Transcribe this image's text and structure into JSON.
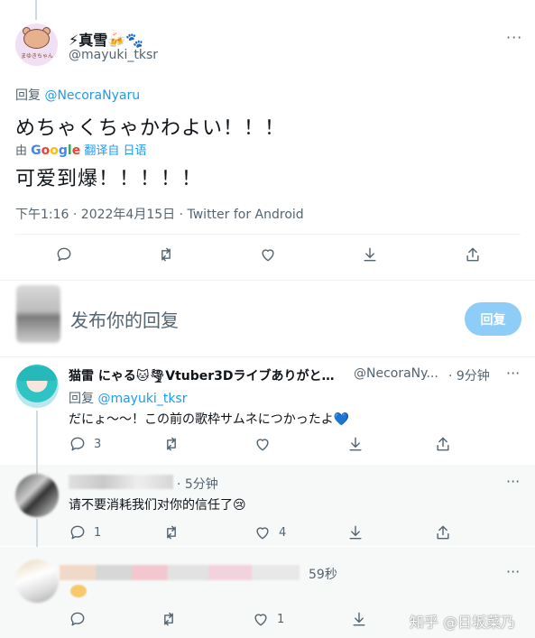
{
  "main_tweet": {
    "display_name": "⚡真雪🍻🐾",
    "handle": "@mayuki_tksr",
    "avatar_caption": "まゆきちゃん",
    "reply_prefix": "回复 ",
    "reply_mention": "@NecoraNyaru",
    "text": "めちゃくちゃかわよい！！！",
    "translated_prefix": "由 ",
    "translated_suffix": "翻译自 日语",
    "translation": "可爱到爆！！！！！",
    "timestamp": "下午1:16 · 2022年4月15日 · Twitter for Android"
  },
  "composer": {
    "placeholder": "发布你的回复",
    "reply_button_label": "回复"
  },
  "replies": [
    {
      "display_name": "猫雷 にゃる🐱🌪Vtuber3Dライブありがと…",
      "handle": "@NecoraNy...",
      "time": "· 9分钟",
      "reply_prefix": "回复 ",
      "reply_mention": "@mayuki_tksr",
      "text": "だにょ～～！この前の歌枠サムネにつかったよ",
      "text_emoji": "💙",
      "reply_count": "3",
      "retweet_count": "",
      "like_count": "",
      "share_count": ""
    },
    {
      "time": "· 5分钟",
      "text": "请不要消耗我们对你的信任了😢",
      "reply_count": "1",
      "retweet_count": "",
      "like_count": "4",
      "share_count": ""
    },
    {
      "time": "59秒",
      "text": "",
      "reply_count": "",
      "retweet_count": "",
      "like_count": "1",
      "share_count": ""
    }
  ],
  "watermark": "知乎 @日坂菜乃",
  "more_glyph": "···",
  "icons": [
    "reply-icon",
    "retweet-icon",
    "like-icon",
    "bookmark-icon",
    "share-icon",
    "more-icon"
  ],
  "colors": {
    "accent": "#1d9bf0",
    "secondary_text": "#536471",
    "reply_button_disabled": "#8ecdf8"
  }
}
